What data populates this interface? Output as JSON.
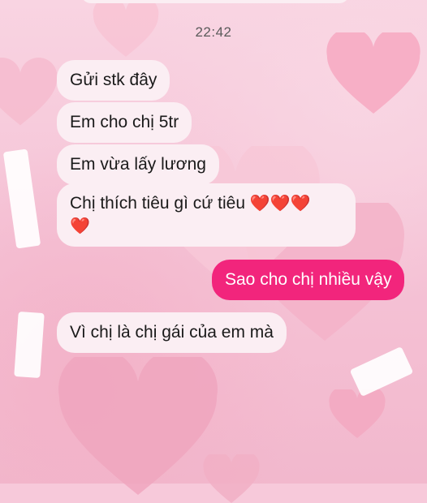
{
  "chat": {
    "timestamp": "22:42",
    "messages": [
      {
        "direction": "incoming",
        "text": "Gửi stk đây"
      },
      {
        "direction": "incoming",
        "text": "Em cho chị 5tr"
      },
      {
        "direction": "incoming",
        "text": "Em vừa lấy lương"
      },
      {
        "direction": "incoming",
        "text": "Chị thích tiêu gì cứ tiêu",
        "emoji": "❤️❤️❤️",
        "emoji_line2": "❤️"
      },
      {
        "direction": "outgoing",
        "text": "Sao cho chị nhiều vậy"
      },
      {
        "direction": "incoming",
        "text": "Vì chị là chị gái của em mà"
      }
    ]
  },
  "colors": {
    "outgoing_bubble": "#f2257c",
    "incoming_bubble": "#fbeef3",
    "background": "#f7c9da"
  },
  "icons": {
    "background_hearts": "heart-icon"
  }
}
